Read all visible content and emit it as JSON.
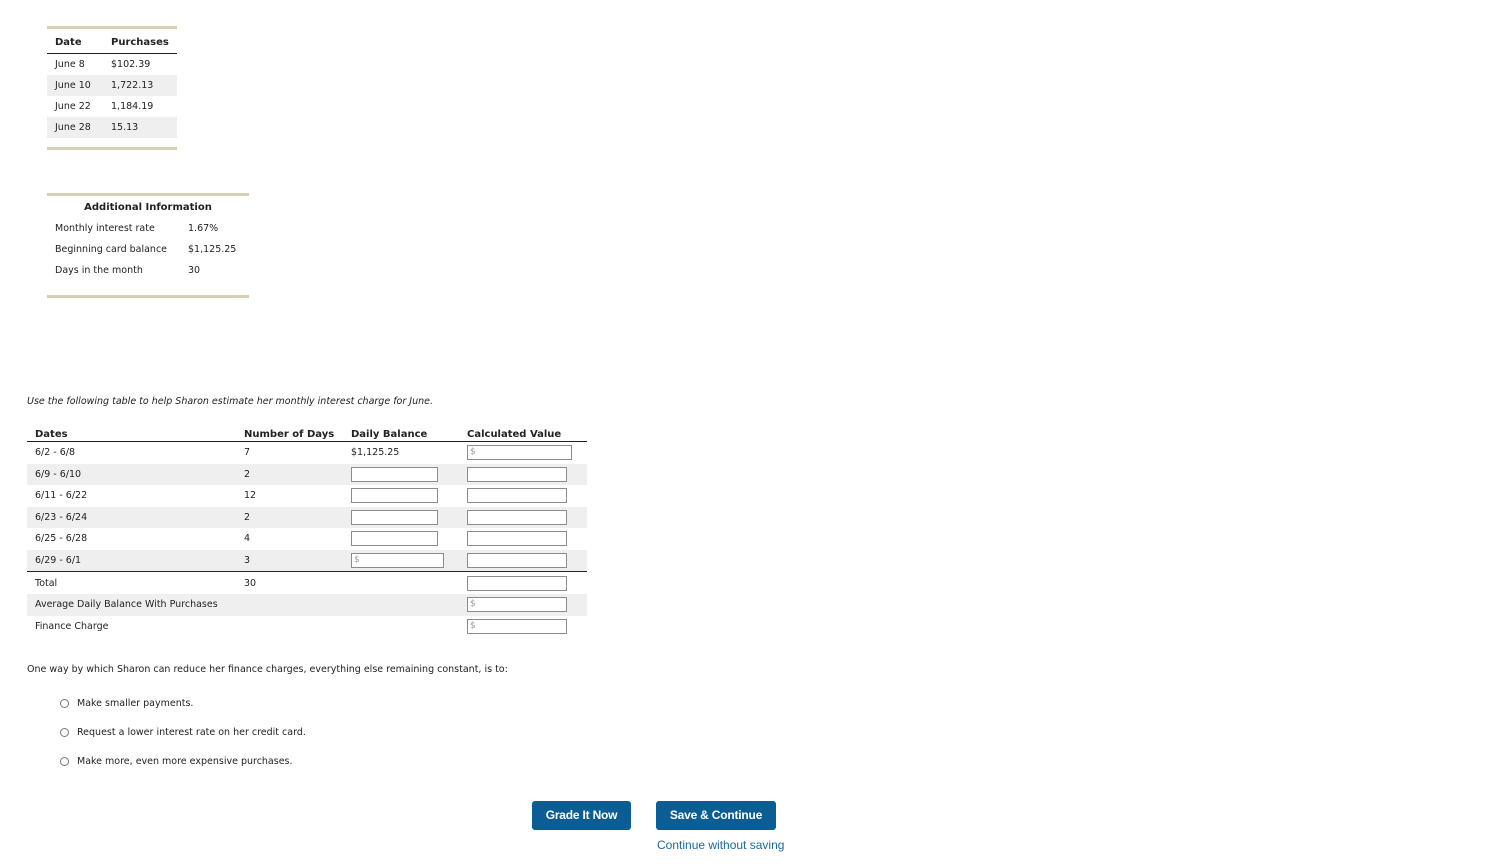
{
  "purchases_table": {
    "headers": [
      "Date",
      "Purchases"
    ],
    "rows": [
      {
        "date": "June 8",
        "amount": "$102.39"
      },
      {
        "date": "June 10",
        "amount": "1,722.13"
      },
      {
        "date": "June 22",
        "amount": "1,184.19"
      },
      {
        "date": "June 28",
        "amount": "15.13"
      }
    ]
  },
  "additional_info": {
    "title": "Additional Information",
    "rows": [
      {
        "label": "Monthly interest rate",
        "value": "1.67%"
      },
      {
        "label": "Beginning card balance",
        "value": "$1,125.25"
      },
      {
        "label": "Days in the month",
        "value": "30"
      }
    ]
  },
  "instruction": "Use the following table to help Sharon estimate her monthly interest charge for June.",
  "calc_table": {
    "headers": [
      "Dates",
      "Number of Days",
      "Daily Balance",
      "Calculated Value"
    ],
    "rows": [
      {
        "dates": "6/2 - 6/8",
        "days": "7",
        "daily_balance": "$1,125.25",
        "daily_input": null,
        "calc_placeholder": "$"
      },
      {
        "dates": "6/9 - 6/10",
        "days": "2",
        "daily_balance": null,
        "daily_input": "",
        "calc_placeholder": ""
      },
      {
        "dates": "6/11 - 6/22",
        "days": "12",
        "daily_balance": null,
        "daily_input": "",
        "calc_placeholder": ""
      },
      {
        "dates": "6/23 - 6/24",
        "days": "2",
        "daily_balance": null,
        "daily_input": "",
        "calc_placeholder": ""
      },
      {
        "dates": "6/25 - 6/28",
        "days": "4",
        "daily_balance": null,
        "daily_input": "",
        "calc_placeholder": ""
      },
      {
        "dates": "6/29 - 6/1",
        "days": "3",
        "daily_balance": null,
        "daily_input": "$",
        "calc_placeholder": ""
      }
    ],
    "total": {
      "label": "Total",
      "days": "30",
      "calc_placeholder": ""
    },
    "avg_daily": {
      "label": "Average Daily Balance With Purchases",
      "calc_placeholder": "$"
    },
    "finance_charge": {
      "label": "Finance Charge",
      "calc_placeholder": "$"
    }
  },
  "question": {
    "text": "One way by which Sharon can reduce her finance charges, everything else remaining constant, is to:",
    "options": [
      "Make smaller payments.",
      "Request a lower interest rate on her credit card.",
      "Make more, even more expensive purchases."
    ]
  },
  "actions": {
    "grade_label": "Grade It Now",
    "save_label": "Save & Continue",
    "continue_label": "Continue without saving"
  }
}
